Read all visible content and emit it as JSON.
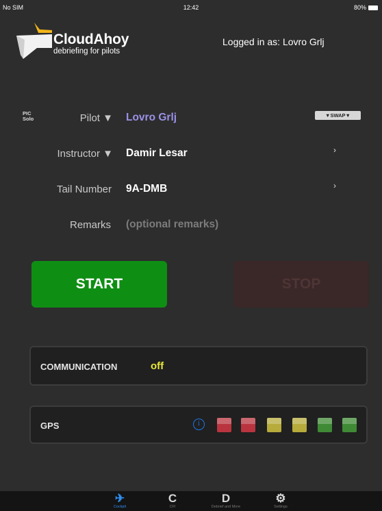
{
  "status_bar": {
    "carrier": "No SIM",
    "time": "12:42",
    "battery": "80%"
  },
  "brand": {
    "name": "CloudAhoy",
    "tagline": "debriefing for pilots"
  },
  "account": {
    "logged_in_text": "Logged in as: Lovro Grlj"
  },
  "flight": {
    "pic_solo": "PIC\nSolo",
    "pilot_label": "Pilot ▼",
    "pilot_value": "Lovro Grlj",
    "swap_label": "▼SWAP▼",
    "instructor_label": "Instructor ▼",
    "instructor_value": "Damir Lesar",
    "tail_label": "Tail Number",
    "tail_value": "9A-DMB",
    "remarks_label": "Remarks",
    "remarks_placeholder": "(optional remarks)",
    "chevron": "›"
  },
  "controls": {
    "start_label": "START",
    "stop_label": "STOP"
  },
  "communication": {
    "label": "COMMUNICATION",
    "status": "off",
    "status_color": "#e8e83a"
  },
  "gps": {
    "label": "GPS",
    "info_icon": "i",
    "lights": [
      "#b9343f",
      "#b9343f",
      "#b7ab3c",
      "#b7ab3c",
      "#3f8a35",
      "#3f8a35"
    ]
  },
  "tabs": [
    {
      "icon": "airplane-icon",
      "glyph": "✈",
      "label": "Cockpit",
      "active": true
    },
    {
      "icon": "cfi-icon",
      "glyph": "C",
      "label": "CFI",
      "active": false
    },
    {
      "icon": "debrief-icon",
      "glyph": "D",
      "label": "Debrief and More",
      "active": false
    },
    {
      "icon": "settings-gear-icon",
      "glyph": "⚙",
      "label": "Settings",
      "active": false
    }
  ],
  "colors": {
    "background": "#2d2d2d",
    "pilot_accent": "#9a92e8",
    "start_green": "#0f8e14",
    "stop_red_disabled": "#3a2727",
    "tab_active_blue": "#2f8ff0"
  }
}
